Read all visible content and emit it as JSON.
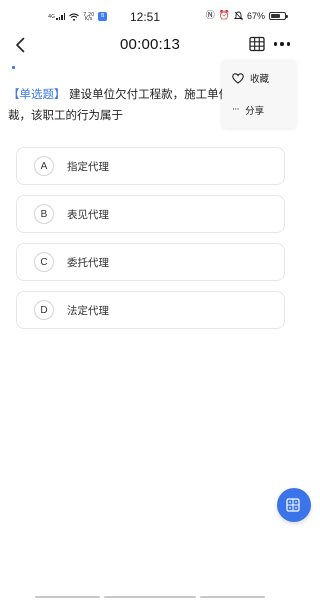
{
  "status_bar": {
    "signal_text": "4G",
    "speed_value": "7.20",
    "speed_unit": "K/s",
    "app_badge": "B",
    "time": "12:51",
    "battery_percent": "67%",
    "battery_level": 0.67
  },
  "header": {
    "timer": "00:00:13"
  },
  "progress": {
    "fraction": 0.01
  },
  "question": {
    "type_label": "【单选题】",
    "text": "建设单位欠付工程款，施工单位职工申请仲裁，该职工的行为属于"
  },
  "options": [
    {
      "letter": "A",
      "text": "指定代理"
    },
    {
      "letter": "B",
      "text": "表见代理"
    },
    {
      "letter": "C",
      "text": "委托代理"
    },
    {
      "letter": "D",
      "text": "法定代理"
    }
  ],
  "menu": {
    "favorite_label": "收藏",
    "share_label": "分享"
  },
  "colors": {
    "accent": "#3b74e8",
    "question_type": "#3a76e8"
  }
}
